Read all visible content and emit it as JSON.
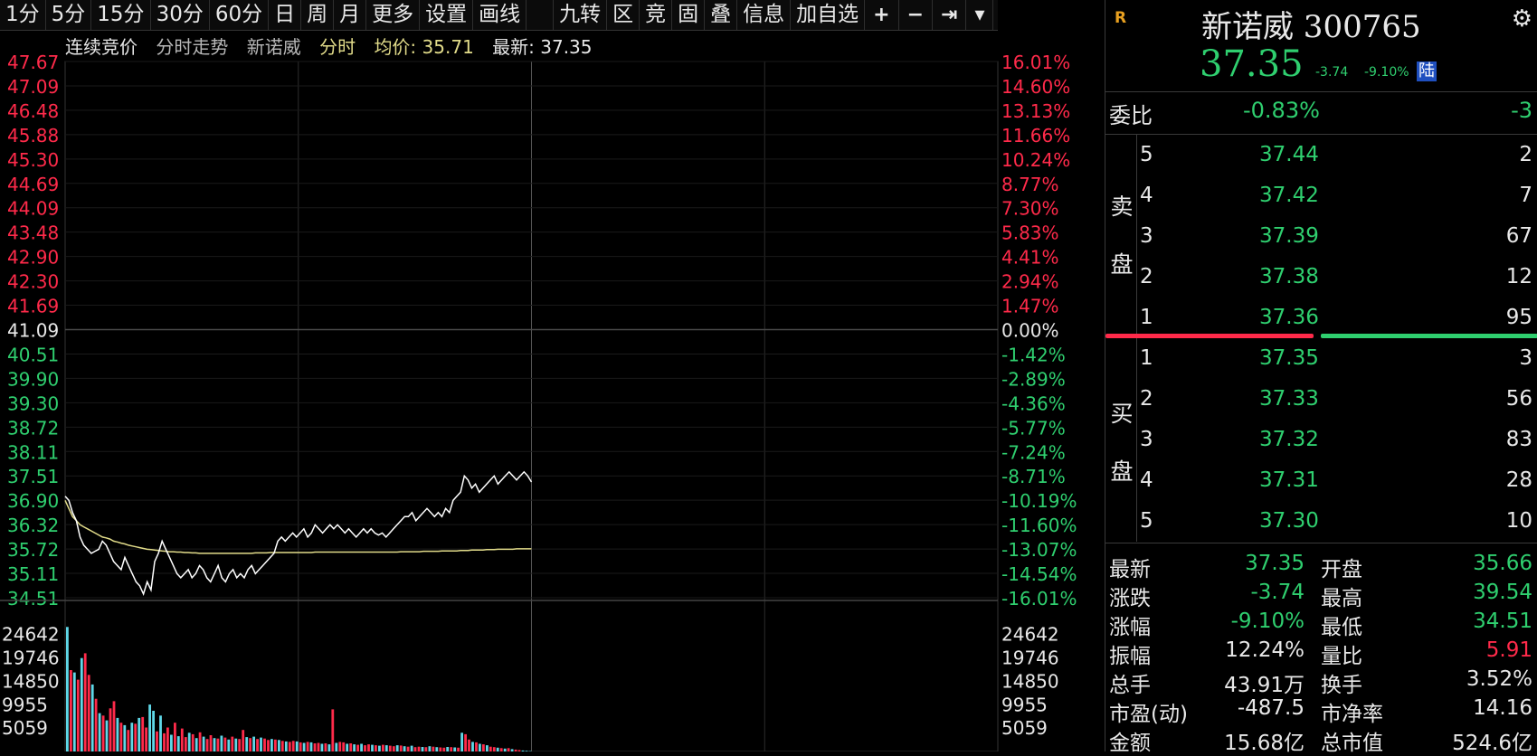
{
  "toolbar": {
    "items": [
      "1分",
      "5分",
      "15分",
      "30分",
      "60分",
      "日",
      "周",
      "月",
      "更多",
      "设置",
      "画线"
    ],
    "tools": [
      "九转",
      "区",
      "竞",
      "固",
      "叠",
      "信息",
      "加自选"
    ],
    "plus": "+",
    "minus": "−",
    "pin": "⇥",
    "dropdown": "▾"
  },
  "subheader": {
    "mode": "连续竞价",
    "view": "分时走势",
    "stock": "新诺威",
    "chart_type": "分时",
    "avg_label": "均价: 35.71",
    "latest_label": "最新: 37.35"
  },
  "colors": {
    "up": "#ff2a4a",
    "down": "#2fcf6f",
    "neutral": "#e8e8e8",
    "avg_line": "#e2dc8a",
    "price_line": "#ffffff",
    "grid": "#2a2a2a"
  },
  "chart_data": {
    "type": "line",
    "title": "新诺威 分时",
    "prev_close": 41.09,
    "y_price_ticks": [
      "47.67",
      "47.09",
      "46.48",
      "45.88",
      "45.30",
      "44.69",
      "44.09",
      "43.48",
      "42.90",
      "42.30",
      "41.69",
      "41.09",
      "40.51",
      "39.90",
      "39.30",
      "38.72",
      "38.11",
      "37.51",
      "36.90",
      "36.32",
      "35.72",
      "35.11",
      "34.51"
    ],
    "y_pct_ticks": [
      "16.01%",
      "14.60%",
      "13.13%",
      "11.66%",
      "10.24%",
      "8.77%",
      "7.30%",
      "5.83%",
      "4.41%",
      "2.94%",
      "1.47%",
      "0.00%",
      "-1.42%",
      "-2.89%",
      "-4.36%",
      "-5.77%",
      "-7.24%",
      "-8.71%",
      "-10.19%",
      "-11.60%",
      "-13.07%",
      "-14.54%",
      "-16.01%"
    ],
    "ylim": [
      34.51,
      47.67
    ],
    "price_series": [
      37.0,
      36.9,
      36.6,
      36.4,
      36.0,
      35.8,
      35.7,
      35.6,
      35.65,
      35.7,
      35.9,
      35.8,
      35.6,
      35.4,
      35.3,
      35.2,
      35.5,
      35.3,
      35.1,
      34.9,
      34.8,
      34.6,
      34.9,
      34.7,
      35.4,
      35.6,
      35.9,
      35.7,
      35.5,
      35.3,
      35.1,
      35.0,
      35.1,
      35.2,
      35.0,
      35.1,
      35.3,
      35.2,
      35.0,
      34.9,
      35.1,
      35.3,
      35.0,
      34.9,
      35.1,
      35.2,
      35.0,
      35.1,
      35.0,
      35.2,
      35.3,
      35.1,
      35.2,
      35.3,
      35.4,
      35.5,
      35.6,
      35.9,
      36.0,
      35.9,
      36.0,
      36.1,
      36.0,
      36.1,
      36.2,
      36.0,
      36.1,
      36.3,
      36.2,
      36.1,
      36.2,
      36.3,
      36.2,
      36.3,
      36.2,
      36.1,
      36.2,
      36.1,
      36.0,
      36.1,
      36.2,
      36.1,
      36.2,
      36.1,
      36.05,
      36.1,
      36.0,
      36.1,
      36.2,
      36.3,
      36.4,
      36.5,
      36.5,
      36.6,
      36.4,
      36.5,
      36.6,
      36.7,
      36.6,
      36.5,
      36.6,
      36.5,
      36.7,
      36.6,
      36.9,
      37.0,
      37.1,
      37.5,
      37.4,
      37.2,
      37.3,
      37.1,
      37.2,
      37.3,
      37.4,
      37.5,
      37.3,
      37.4,
      37.5,
      37.6,
      37.5,
      37.4,
      37.5,
      37.6,
      37.5,
      37.35
    ],
    "avg_series": [
      36.9,
      36.7,
      36.5,
      36.4,
      36.3,
      36.25,
      36.2,
      36.15,
      36.1,
      36.05,
      36.0,
      35.98,
      35.95,
      35.9,
      35.88,
      35.85,
      35.83,
      35.8,
      35.78,
      35.76,
      35.74,
      35.72,
      35.7,
      35.69,
      35.68,
      35.67,
      35.66,
      35.65,
      35.64,
      35.64,
      35.63,
      35.63,
      35.62,
      35.62,
      35.61,
      35.61,
      35.6,
      35.6,
      35.6,
      35.6,
      35.6,
      35.6,
      35.6,
      35.6,
      35.6,
      35.6,
      35.6,
      35.6,
      35.6,
      35.6,
      35.6,
      35.61,
      35.61,
      35.61,
      35.61,
      35.62,
      35.62,
      35.62,
      35.62,
      35.62,
      35.62,
      35.62,
      35.62,
      35.62,
      35.62,
      35.62,
      35.62,
      35.63,
      35.63,
      35.63,
      35.63,
      35.63,
      35.63,
      35.63,
      35.63,
      35.63,
      35.63,
      35.63,
      35.63,
      35.63,
      35.63,
      35.63,
      35.63,
      35.63,
      35.63,
      35.63,
      35.63,
      35.63,
      35.63,
      35.63,
      35.64,
      35.64,
      35.64,
      35.64,
      35.64,
      35.64,
      35.65,
      35.65,
      35.65,
      35.65,
      35.65,
      35.66,
      35.66,
      35.66,
      35.66,
      35.66,
      35.67,
      35.67,
      35.67,
      35.68,
      35.68,
      35.68,
      35.68,
      35.69,
      35.69,
      35.69,
      35.7,
      35.7,
      35.7,
      35.7,
      35.7,
      35.71,
      35.71,
      35.71,
      35.71,
      35.71
    ],
    "vol_ticks": [
      "24642",
      "19746",
      "14850",
      "9955",
      "5059"
    ],
    "vol_ylim": [
      0,
      27000
    ],
    "volume": [
      26000,
      17000,
      16500,
      15000,
      19500,
      20500,
      16000,
      14000,
      11000,
      8000,
      7500,
      6500,
      9000,
      10500,
      7000,
      6000,
      5500,
      4500,
      6000,
      5800,
      7000,
      7200,
      5000,
      9800,
      8500,
      4200,
      7500,
      3800,
      5000,
      3500,
      6000,
      3200,
      4800,
      3000,
      3900,
      3600,
      2800,
      4000,
      3100,
      2600,
      3400,
      2800,
      2700,
      3300,
      2900,
      2500,
      3100,
      2700,
      2600,
      4500,
      3000,
      2800,
      3100,
      2600,
      2900,
      2700,
      2400,
      2600,
      2500,
      2400,
      2200,
      2100,
      2000,
      2200,
      2100,
      1900,
      1800,
      2000,
      1900,
      1700,
      1800,
      1600,
      1700,
      1500,
      8800,
      1800,
      2000,
      1900,
      1600,
      1700,
      1500,
      1400,
      1600,
      1300,
      1500,
      1400,
      1300,
      1200,
      1400,
      1300,
      1200,
      1100,
      1300,
      1250,
      1100,
      1000,
      1200,
      900,
      1000,
      950,
      900,
      1100,
      1000,
      900,
      850,
      800,
      950,
      900,
      850,
      800,
      3900,
      3600,
      2500,
      2000,
      1900,
      1600,
      1500,
      1300,
      1000,
      900,
      800,
      700,
      600,
      700,
      500,
      400,
      300,
      200,
      150,
      100
    ],
    "vol_colors": [
      "d",
      "u",
      "d",
      "u",
      "d",
      "u",
      "u",
      "d",
      "u",
      "d",
      "u",
      "d",
      "u",
      "u",
      "d",
      "u",
      "d",
      "u",
      "d",
      "u",
      "d",
      "u",
      "u",
      "d",
      "d",
      "u",
      "d",
      "u",
      "u",
      "d",
      "u",
      "d",
      "u",
      "u",
      "d",
      "u",
      "d",
      "u",
      "d",
      "u",
      "u",
      "d",
      "u",
      "d",
      "u",
      "d",
      "u",
      "d",
      "u",
      "u",
      "d",
      "u",
      "d",
      "u",
      "d",
      "u",
      "u",
      "d",
      "u",
      "d",
      "u",
      "d",
      "u",
      "u",
      "d",
      "u",
      "d",
      "u",
      "d",
      "u",
      "u",
      "d",
      "u",
      "d",
      "u",
      "d",
      "u",
      "u",
      "d",
      "u",
      "d",
      "u",
      "d",
      "u",
      "u",
      "d",
      "u",
      "d",
      "u",
      "d",
      "u",
      "u",
      "d",
      "u",
      "d",
      "u",
      "d",
      "u",
      "u",
      "d",
      "u",
      "d",
      "u",
      "d",
      "u",
      "u",
      "d",
      "u",
      "d",
      "u",
      "d",
      "u",
      "u",
      "d",
      "u",
      "d",
      "u",
      "d",
      "u",
      "u",
      "d",
      "u",
      "d",
      "u",
      "d",
      "u",
      "u",
      "d"
    ]
  },
  "right": {
    "logo": "R",
    "title": "新诺威 300765",
    "gear": "⚙",
    "price": "37.35",
    "change": "-3.74",
    "change_pct": "-9.10%",
    "market_badge": "陆",
    "weibi_label": "委比",
    "weibi_value": "-0.83%",
    "weibi_num": "-3",
    "sell_label_1": "卖",
    "sell_label_2": "盘",
    "buy_label_1": "买",
    "buy_label_2": "盘",
    "sell": [
      {
        "lv": "5",
        "px": "37.44",
        "vol": "2"
      },
      {
        "lv": "4",
        "px": "37.42",
        "vol": "7"
      },
      {
        "lv": "3",
        "px": "37.39",
        "vol": "67"
      },
      {
        "lv": "2",
        "px": "37.38",
        "vol": "12"
      },
      {
        "lv": "1",
        "px": "37.36",
        "vol": "95"
      }
    ],
    "buy": [
      {
        "lv": "1",
        "px": "37.35",
        "vol": "3"
      },
      {
        "lv": "2",
        "px": "37.33",
        "vol": "56"
      },
      {
        "lv": "3",
        "px": "37.32",
        "vol": "83"
      },
      {
        "lv": "4",
        "px": "37.31",
        "vol": "28"
      },
      {
        "lv": "5",
        "px": "37.30",
        "vol": "10"
      }
    ],
    "stats": [
      {
        "k1": "最新",
        "v1": "37.35",
        "c1": "down",
        "k2": "开盘",
        "v2": "35.66",
        "c2": "down"
      },
      {
        "k1": "涨跌",
        "v1": "-3.74",
        "c1": "down",
        "k2": "最高",
        "v2": "39.54",
        "c2": "down"
      },
      {
        "k1": "涨幅",
        "v1": "-9.10%",
        "c1": "down",
        "k2": "最低",
        "v2": "34.51",
        "c2": "down"
      },
      {
        "k1": "振幅",
        "v1": "12.24%",
        "c1": "neutral",
        "k2": "量比",
        "v2": "5.91",
        "c2": "up"
      },
      {
        "k1": "总手",
        "v1": "43.91万",
        "c1": "neutral",
        "k2": "换手",
        "v2": "3.52%",
        "c2": "neutral"
      },
      {
        "k1": "市盈(动)",
        "v1": "-487.5",
        "c1": "neutral",
        "k2": "市净率",
        "v2": "14.16",
        "c2": "neutral"
      },
      {
        "k1": "金额",
        "v1": "15.68亿",
        "c1": "neutral",
        "k2": "总市值",
        "v2": "524.6亿",
        "c2": "neutral"
      }
    ]
  }
}
